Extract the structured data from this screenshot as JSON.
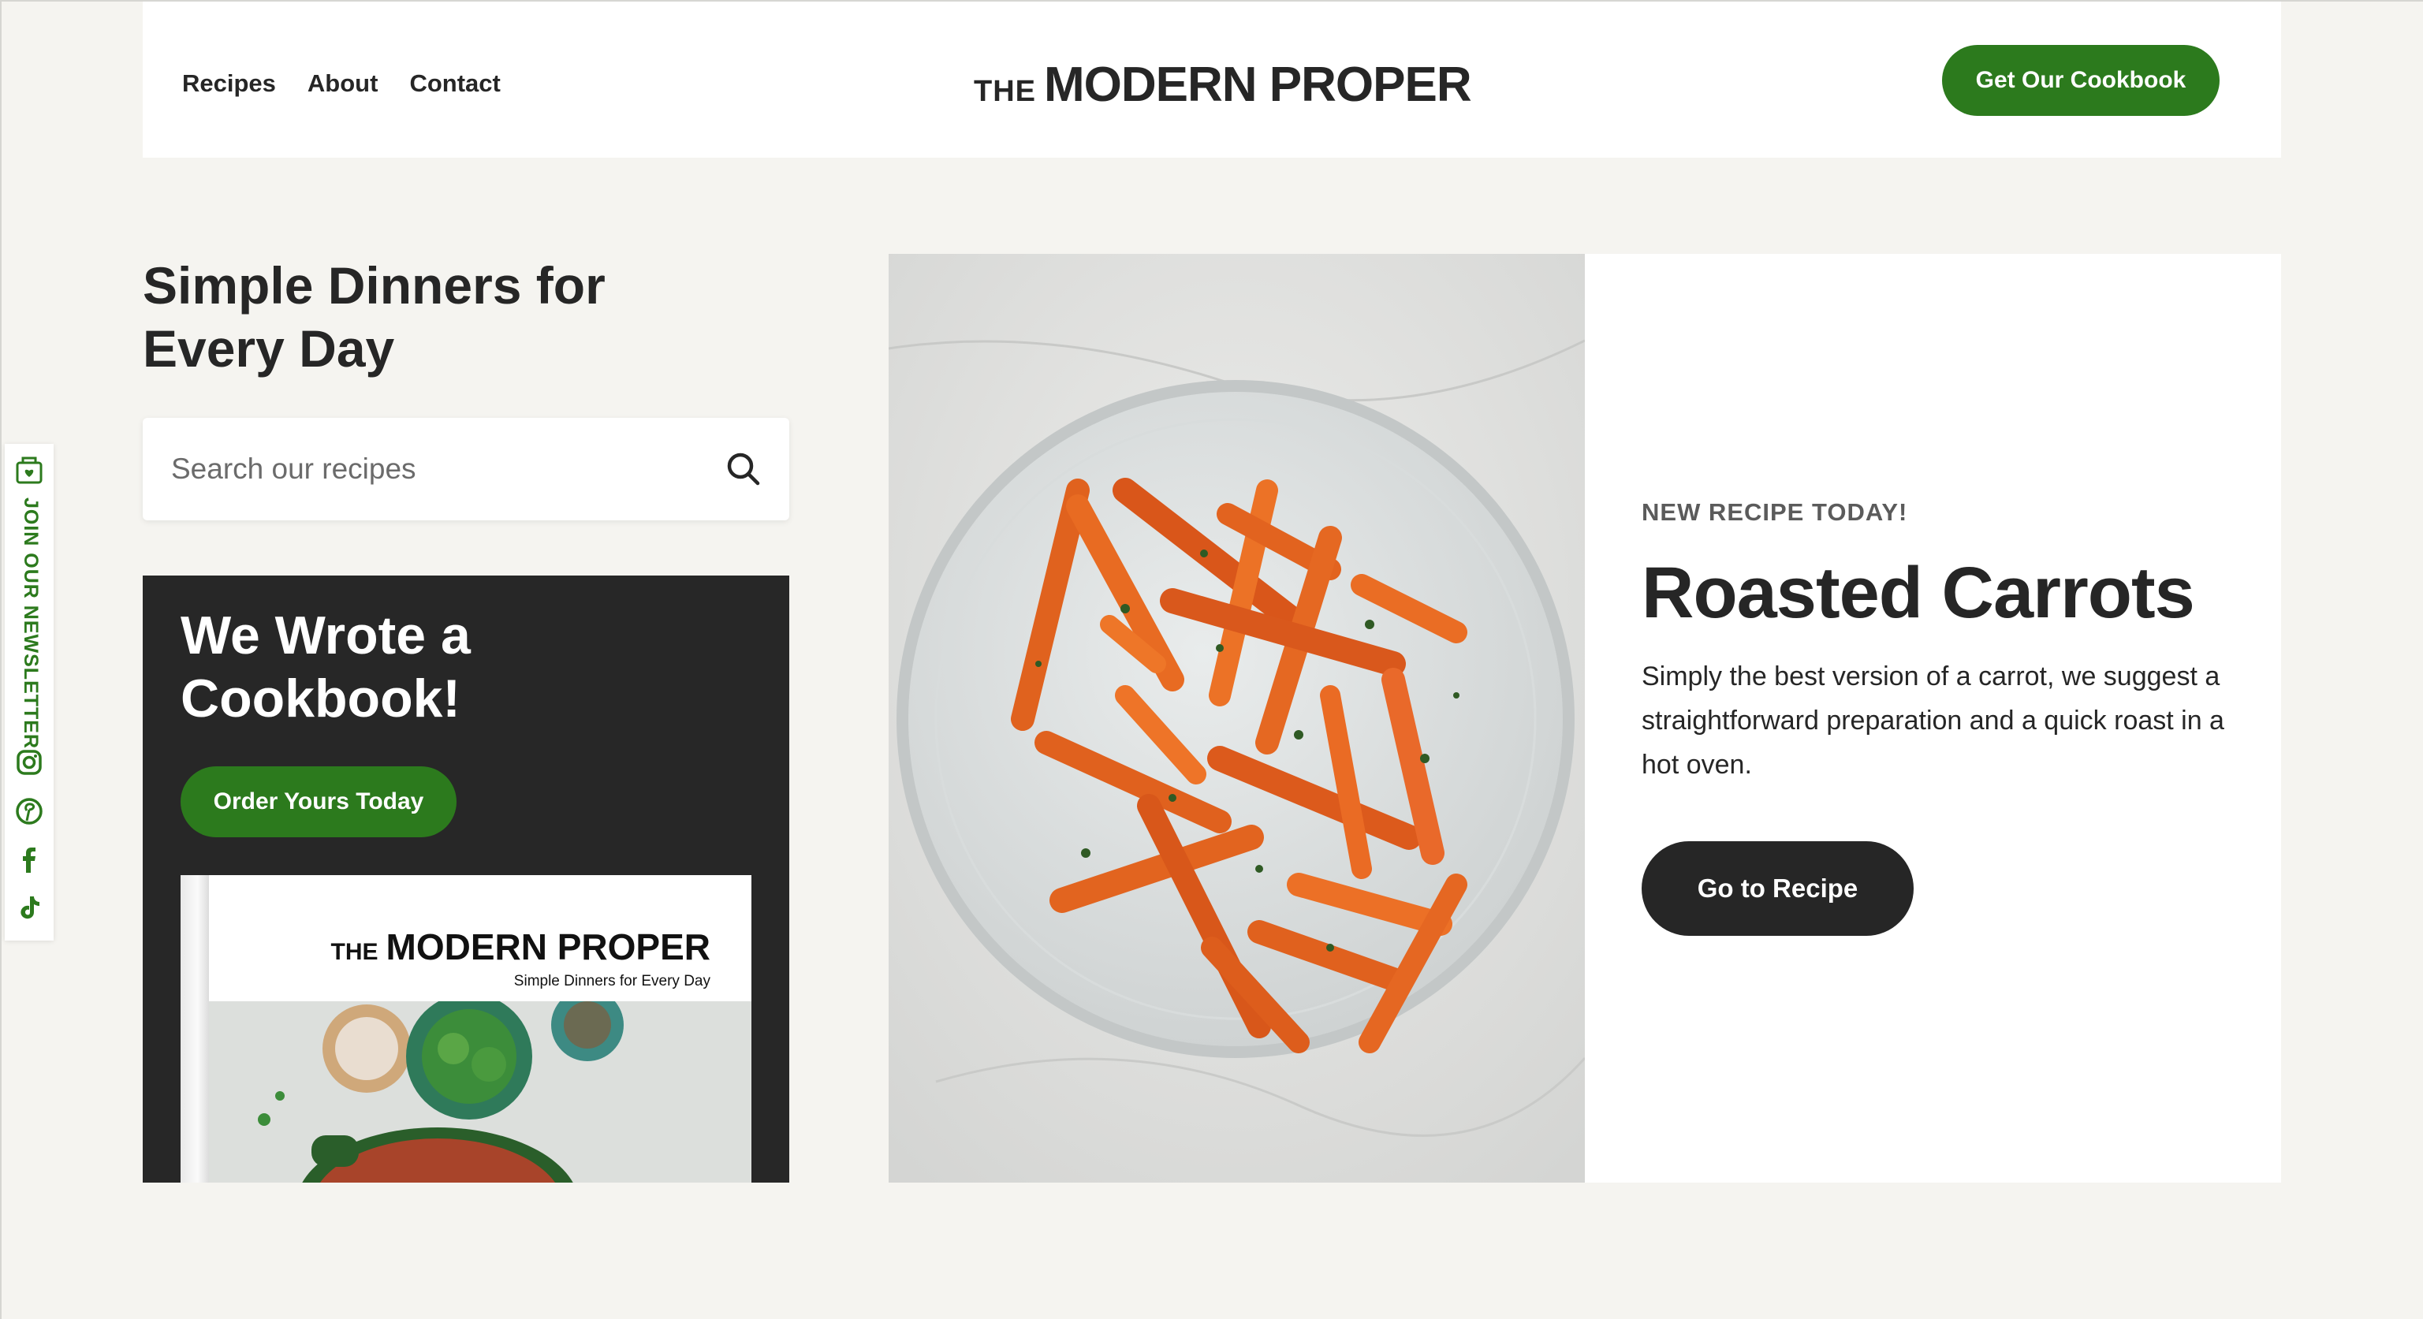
{
  "header": {
    "nav": [
      "Recipes",
      "About",
      "Contact"
    ],
    "logo_the": "THE",
    "logo_main": "MODERN PROPER",
    "cta_label": "Get Our Cookbook"
  },
  "hero": {
    "title": "Simple Dinners for Every Day",
    "search_placeholder": "Search our recipes",
    "search_icon": "search-icon"
  },
  "promo": {
    "title": "We Wrote a Cookbook!",
    "button_label": "Order Yours Today",
    "book_logo_the": "THE",
    "book_logo_main": "MODERN PROPER",
    "book_subtitle": "Simple Dinners for Every Day"
  },
  "feature": {
    "kicker": "NEW RECIPE TODAY!",
    "title": "Roasted Carrots",
    "description": "Simply the best version of a carrot, we suggest a straightforward preparation and a quick roast in a hot oven.",
    "button_label": "Go to Recipe"
  },
  "sidebar": {
    "newsletter_label": "JOIN OUR NEWSLETTER",
    "icons": [
      "newsletter-icon",
      "instagram-icon",
      "pinterest-icon",
      "facebook-icon",
      "tiktok-icon"
    ]
  },
  "colors": {
    "accent_green": "#2c7a1d",
    "dark": "#262626",
    "background": "#f5f4f0"
  }
}
